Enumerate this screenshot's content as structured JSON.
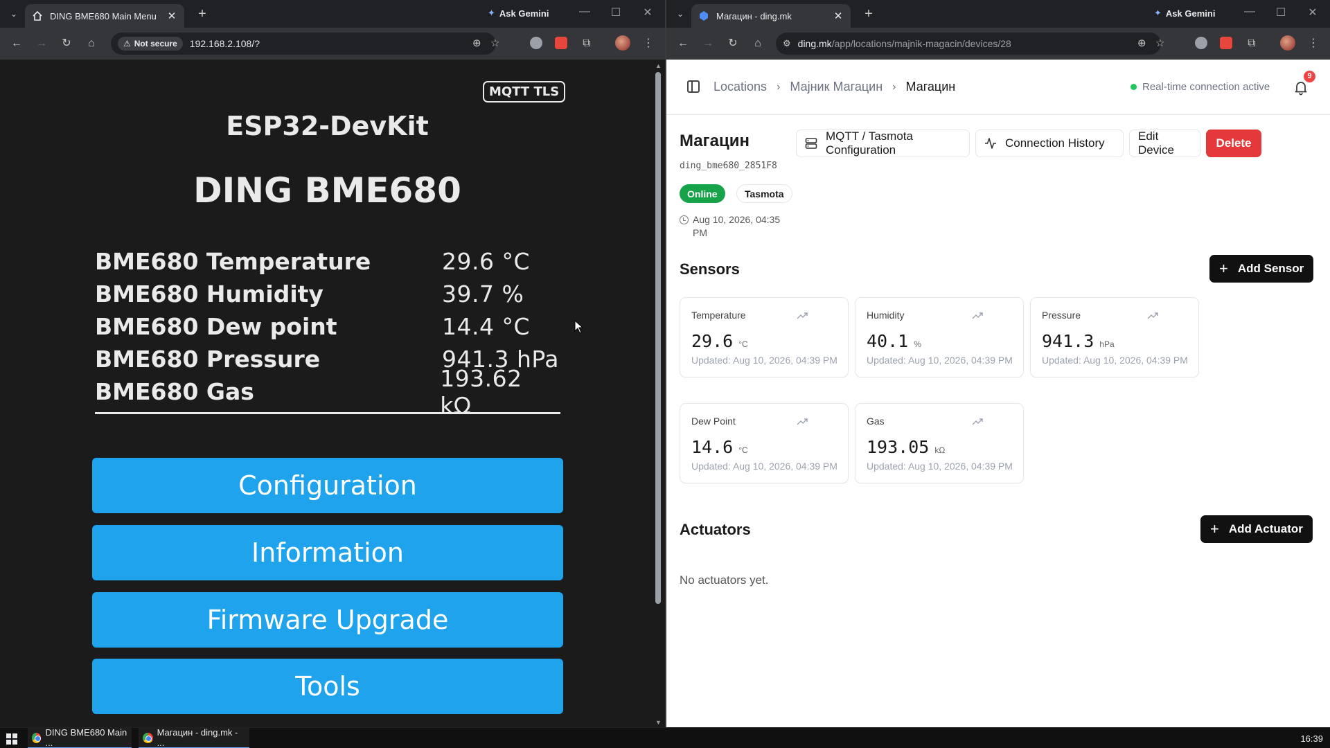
{
  "left_browser": {
    "tab_title": "DING BME680 Main Menu",
    "gemini_label": "Ask Gemini",
    "security_chip": "Not secure",
    "url": "192.168.2.108/?"
  },
  "right_browser": {
    "tab_title": "Магацин - ding.mk",
    "gemini_label": "Ask Gemini",
    "url_host": "ding.mk",
    "url_path": "/app/locations/majnik-magacin/devices/28"
  },
  "tasmota": {
    "badge": "MQTT TLS",
    "module": "ESP32-DevKit",
    "device": "DING BME680",
    "sensors": [
      {
        "name": "BME680 Temperature",
        "value": "29.6 °C"
      },
      {
        "name": "BME680 Humidity",
        "value": "39.7 %"
      },
      {
        "name": "BME680 Dew point",
        "value": "14.4 °C"
      },
      {
        "name": "BME680 Pressure",
        "value": "941.3 hPa"
      },
      {
        "name": "BME680 Gas",
        "value": "193.62 kΩ"
      }
    ],
    "buttons": [
      "Configuration",
      "Information",
      "Firmware Upgrade",
      "Tools"
    ]
  },
  "ding": {
    "breadcrumbs": [
      "Locations",
      "Мајник Магацин",
      "Магацин"
    ],
    "realtime_status": "Real-time connection active",
    "notification_count": "9",
    "device": {
      "name": "Магацин",
      "id": "ding_bme680_2851F8",
      "status": "Online",
      "type": "Tasmota",
      "last_seen_line1": "Aug 10, 2026, 04:35",
      "last_seen_line2": "PM"
    },
    "actions": {
      "mqtt": "MQTT / Tasmota Configuration",
      "history": "Connection History",
      "edit": "Edit Device",
      "delete": "Delete"
    },
    "sensors_title": "Sensors",
    "add_sensor": "Add Sensor",
    "sensor_cards": [
      {
        "name": "Temperature",
        "value": "29.6",
        "unit": "°C",
        "updated": "Updated: Aug 10, 2026, 04:39 PM"
      },
      {
        "name": "Humidity",
        "value": "40.1",
        "unit": "%",
        "updated": "Updated: Aug 10, 2026, 04:39 PM"
      },
      {
        "name": "Pressure",
        "value": "941.3",
        "unit": "hPa",
        "updated": "Updated: Aug 10, 2026, 04:39 PM"
      },
      {
        "name": "Dew Point",
        "value": "14.6",
        "unit": "°C",
        "updated": "Updated: Aug 10, 2026, 04:39 PM"
      },
      {
        "name": "Gas",
        "value": "193.05",
        "unit": "kΩ",
        "updated": "Updated: Aug 10, 2026, 04:39 PM"
      }
    ],
    "actuators_title": "Actuators",
    "add_actuator": "Add Actuator",
    "no_actuators": "No actuators yet."
  },
  "taskbar": {
    "items": [
      "DING BME680 Main ...",
      "Магацин - ding.mk - ..."
    ],
    "time": "16:39"
  },
  "colors": {
    "tasmota_button": "#1fa3ec",
    "online": "#16a34a",
    "delete": "#e5383b",
    "realtime_dot": "#22c55e"
  }
}
